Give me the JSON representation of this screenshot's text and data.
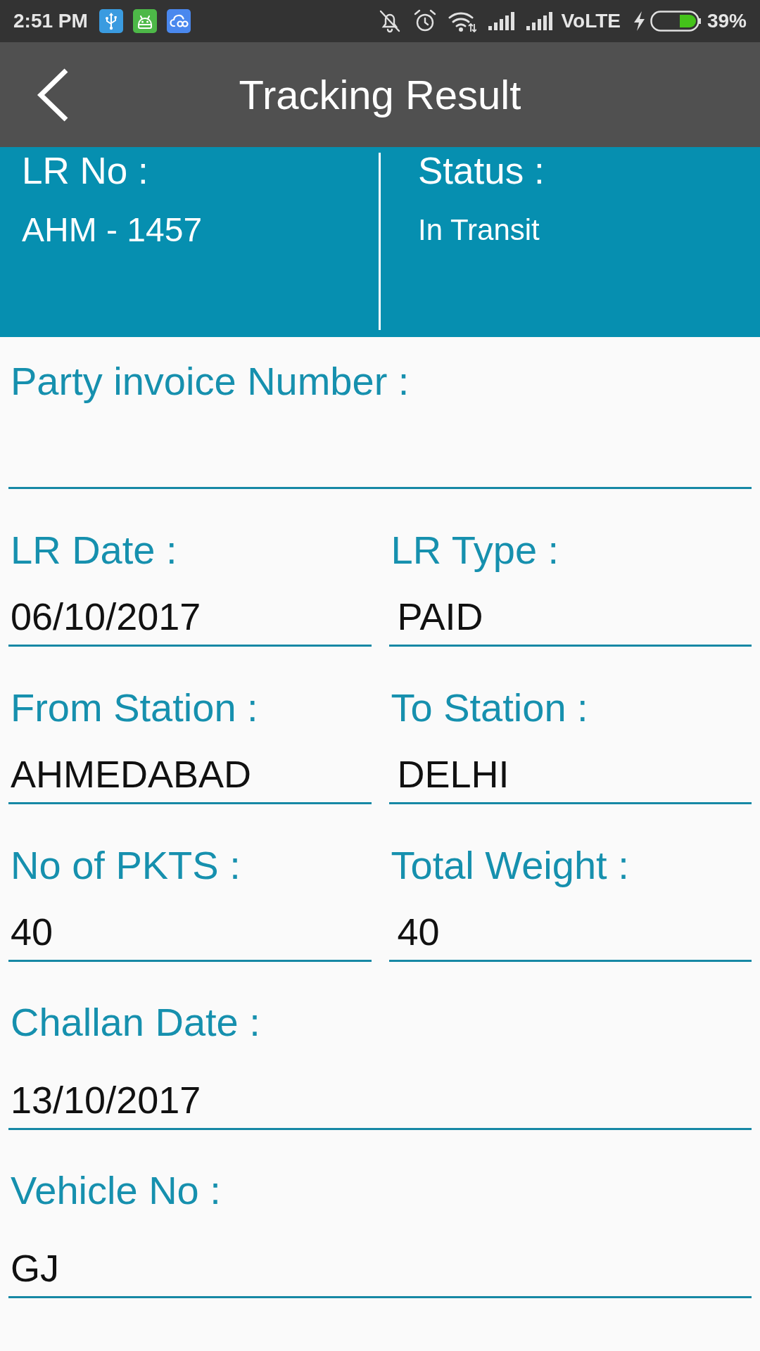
{
  "status_bar": {
    "time": "2:51 PM",
    "network": "VoLTE",
    "battery": "39%"
  },
  "app_bar": {
    "title": "Tracking Result"
  },
  "summary": [
    {
      "label": "LR No :",
      "value": "AHM - 1457"
    },
    {
      "label": "Status :",
      "value": "In Transit"
    }
  ],
  "form": {
    "rows": [
      {
        "fields": [
          {
            "label": "Party invoice Number :"
          }
        ]
      },
      {
        "fields": [
          {
            "label": "LR Date :",
            "value": "06/10/2017"
          },
          {
            "label": "LR Type :",
            "value": "PAID"
          }
        ]
      },
      {
        "fields": [
          {
            "label": "From Station :",
            "value": "AHMEDABAD"
          },
          {
            "label": "To Station :",
            "value": "DELHI"
          }
        ]
      },
      {
        "fields": [
          {
            "label": "No of PKTS :",
            "value": "40"
          },
          {
            "label": "Total Weight :",
            "value": "40"
          }
        ]
      },
      {
        "fields": [
          {
            "label": "Challan Date :",
            "value": "13/10/2017"
          }
        ]
      },
      {
        "fields": [
          {
            "label": "Vehicle No :",
            "value": "GJ"
          }
        ]
      }
    ]
  }
}
